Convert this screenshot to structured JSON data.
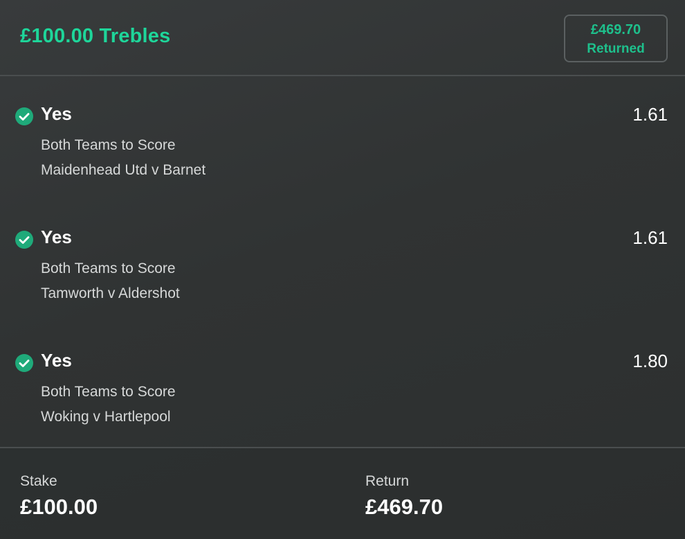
{
  "header": {
    "title": "£100.00 Trebles",
    "returned_amount": "£469.70",
    "returned_label": "Returned"
  },
  "colors": {
    "accent": "#1ed69a",
    "check": "#1faa7a",
    "background": "#303333",
    "divider": "#4a4e4f"
  },
  "selections": [
    {
      "icon": "check-circle-icon",
      "name": "Yes",
      "odds": "1.61",
      "market": "Both Teams to Score",
      "event": "Maidenhead Utd v Barnet"
    },
    {
      "icon": "check-circle-icon",
      "name": "Yes",
      "odds": "1.61",
      "market": "Both Teams to Score",
      "event": "Tamworth v Aldershot"
    },
    {
      "icon": "check-circle-icon",
      "name": "Yes",
      "odds": "1.80",
      "market": "Both Teams to Score",
      "event": "Woking v Hartlepool"
    }
  ],
  "footer": {
    "stake_label": "Stake",
    "stake_value": "£100.00",
    "return_label": "Return",
    "return_value": "£469.70"
  }
}
